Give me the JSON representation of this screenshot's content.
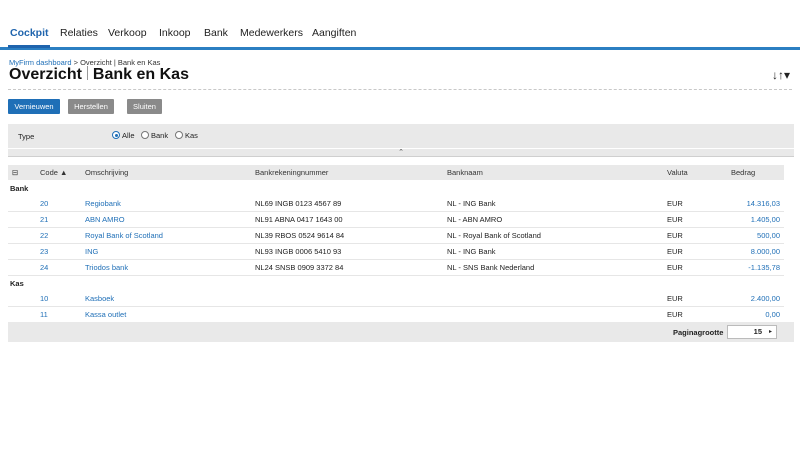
{
  "nav": {
    "tabs": [
      {
        "label": "Cockpit",
        "active": true
      },
      {
        "label": "Relaties"
      },
      {
        "label": "Verkoop"
      },
      {
        "label": "Inkoop"
      },
      {
        "label": "Bank"
      },
      {
        "label": "Medewerkers"
      },
      {
        "label": "Aangiften"
      }
    ]
  },
  "header": {
    "breadcrumb_link": "MyFirm dashboard",
    "breadcrumb_rest": " > Overzicht | Bank en Kas",
    "title_part1": "Overzicht",
    "title_part2": "Bank en Kas",
    "sort_icon": "sort-tool-icon",
    "sort_glyph": "↓↑▾"
  },
  "buttons": {
    "refresh": "Vernieuwen",
    "reset": "Herstellen",
    "close": "Sluiten"
  },
  "filter": {
    "label": "Type",
    "options": [
      "Alle",
      "Bank",
      "Kas"
    ],
    "selected": "Alle",
    "collapse_glyph": "⌃"
  },
  "table": {
    "columns": {
      "icon": "⊟",
      "code": "Code ▲",
      "omschrijving": "Omschrijving",
      "iban": "Bankrekeningnummer",
      "banknaam": "Banknaam",
      "valuta": "Valuta",
      "bedrag": "Bedrag"
    },
    "group_bank": "Bank",
    "group_kas": "Kas",
    "bank_rows": [
      {
        "code": "20",
        "omschrijving": "Regiobank",
        "iban": "NL69 INGB 0123 4567 89",
        "banknaam": "NL - ING Bank",
        "valuta": "EUR",
        "bedrag": "14.316,03"
      },
      {
        "code": "21",
        "omschrijving": "ABN AMRO",
        "iban": "NL91 ABNA 0417 1643 00",
        "banknaam": "NL - ABN AMRO",
        "valuta": "EUR",
        "bedrag": "1.405,00"
      },
      {
        "code": "22",
        "omschrijving": "Royal Bank of Scotland",
        "iban": "NL39 RBOS 0524 9614 84",
        "banknaam": "NL - Royal Bank of Scotland",
        "valuta": "EUR",
        "bedrag": "500,00"
      },
      {
        "code": "23",
        "omschrijving": "ING",
        "iban": "NL93 INGB 0006 5410 93",
        "banknaam": "NL - ING Bank",
        "valuta": "EUR",
        "bedrag": "8.000,00"
      },
      {
        "code": "24",
        "omschrijving": "Triodos bank",
        "iban": "NL24 SNSB 0909 3372 84",
        "banknaam": "NL - SNS Bank Nederland",
        "valuta": "EUR",
        "bedrag": "-1.135,78"
      }
    ],
    "kas_rows": [
      {
        "code": "10",
        "omschrijving": "Kasboek",
        "iban": "",
        "banknaam": "",
        "valuta": "EUR",
        "bedrag": "2.400,00"
      },
      {
        "code": "11",
        "omschrijving": "Kassa outlet",
        "iban": "",
        "banknaam": "",
        "valuta": "EUR",
        "bedrag": "0,00"
      }
    ]
  },
  "footer": {
    "page_size_label": "Paginagrootte",
    "page_size_value": "15",
    "arrow": "▸"
  },
  "colors": {
    "accent": "#1f6fb7",
    "nav_border": "#2b7fc2",
    "grey_button": "#8a8a8a",
    "panel_bg": "#e9e9e9"
  }
}
